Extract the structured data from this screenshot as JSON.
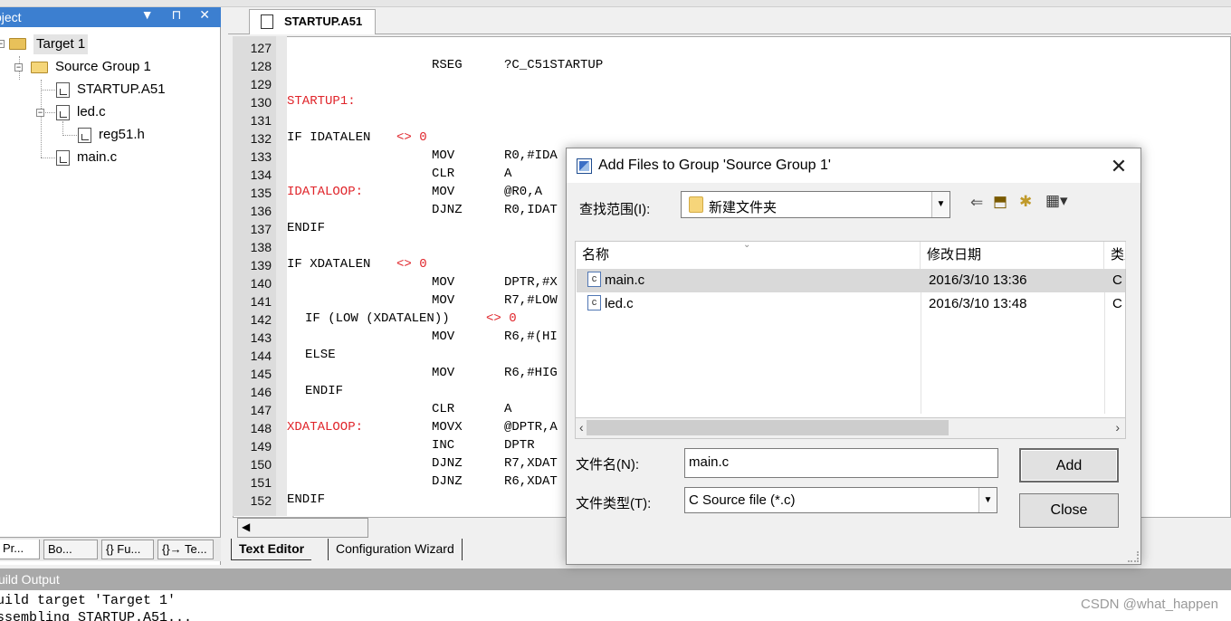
{
  "project_panel": {
    "title": "oject",
    "title_buttons": "▼ ⊓ ✕",
    "tree": {
      "target": "Target 1",
      "group": "Source Group 1",
      "files": [
        "STARTUP.A51",
        "led.c",
        "reg51.h",
        "main.c"
      ]
    },
    "tabs": [
      "Pr...",
      "Bo...",
      "{} Fu...",
      "{}→ Te..."
    ]
  },
  "editor": {
    "tab_label": "STARTUP.A51",
    "line_numbers": [
      "127",
      "128",
      "129",
      "130",
      "131",
      "132",
      "133",
      "134",
      "135",
      "136",
      "137",
      "138",
      "139",
      "140",
      "141",
      "142",
      "143",
      "144",
      "145",
      "146",
      "147",
      "148",
      "149",
      "150",
      "151",
      "152"
    ],
    "code": {
      "l128_op": "RSEG",
      "l128_arg": "?C_C51STARTUP",
      "l130_label": "STARTUP1:",
      "l132": "IF IDATALEN",
      "l132_ne": "<> 0",
      "l133_op": "MOV",
      "l133_arg": "R0,#IDA",
      "l134_op": "CLR",
      "l134_arg": "A",
      "l135_label": "IDATALOOP:",
      "l135_op": "MOV",
      "l135_arg": "@R0,A",
      "l136_op": "DJNZ",
      "l136_arg": "R0,IDAT",
      "l137": "ENDIF",
      "l139": "IF XDATALEN",
      "l139_ne": "<> 0",
      "l140_op": "MOV",
      "l140_arg": "DPTR,#X",
      "l141_op": "MOV",
      "l141_arg": "R7,#LOW",
      "l142": "IF (LOW (XDATALEN))",
      "l142_ne": "<> 0",
      "l143_op": "MOV",
      "l143_arg": "R6,#(HI",
      "l144": "ELSE",
      "l145_op": "MOV",
      "l145_arg": "R6,#HIG",
      "l146": "ENDIF",
      "l147_op": "CLR",
      "l147_arg": "A",
      "l148_label": "XDATALOOP:",
      "l148_op": "MOVX",
      "l148_arg": "@DPTR,A",
      "l149_op": "INC",
      "l149_arg": "DPTR",
      "l150_op": "DJNZ",
      "l150_arg": "R7,XDAT",
      "l151_op": "DJNZ",
      "l151_arg": "R6,XDAT",
      "l152": "ENDIF"
    },
    "bottom_tabs": [
      "Text Editor",
      "Configuration Wizard"
    ]
  },
  "build_output": {
    "title": "uild Output",
    "lines": [
      "uild target 'Target 1'",
      "ssembling STARTUP.A51..."
    ]
  },
  "watermark": "CSDN @what_happen",
  "dialog": {
    "title": "Add Files to Group 'Source Group 1'",
    "look_in_label": "查找范围(I):",
    "look_in_value": "新建文件夹",
    "columns": [
      "名称",
      "修改日期",
      "类型"
    ],
    "files": [
      {
        "name": "main.c",
        "date": "2016/3/10 13:36",
        "type": "C Source"
      },
      {
        "name": "led.c",
        "date": "2016/3/10 13:48",
        "type": "C Source"
      }
    ],
    "filename_label": "文件名(N):",
    "filename_value": "main.c",
    "filetype_label": "文件类型(T):",
    "filetype_value": "C Source file (*.c)",
    "add_label": "Add",
    "close_label": "Close",
    "colors": {
      "selected_row": "#d9d9d9",
      "title_icon": "#3b6fc6"
    }
  }
}
